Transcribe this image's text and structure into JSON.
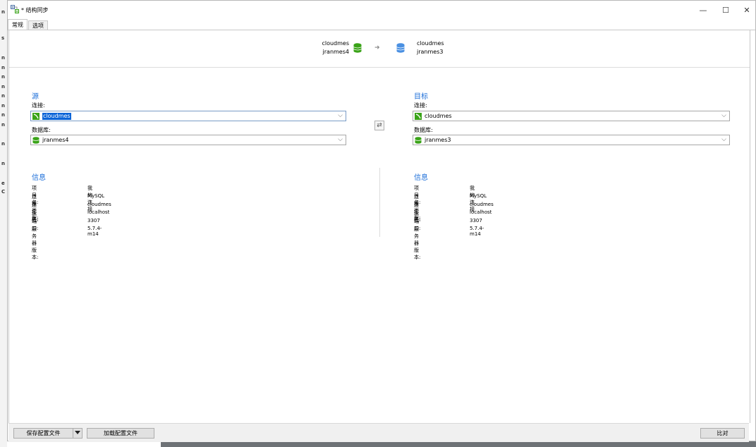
{
  "window": {
    "title": "* 结构同步",
    "min": "—",
    "max": "☐",
    "close": "✕"
  },
  "tabs": [
    {
      "label": "常规"
    },
    {
      "label": "选项"
    }
  ],
  "header": {
    "source_connection": "cloudmes",
    "source_database": "jranmes4",
    "target_connection": "cloudmes",
    "target_database": "jranmes3",
    "arrow": "➜"
  },
  "source": {
    "title": "源",
    "connection_label": "连接:",
    "connection_value": "cloudmes",
    "database_label": "数据库:",
    "database_value": "jranmes4"
  },
  "target": {
    "title": "目标",
    "connection_label": "连接:",
    "connection_value": "cloudmes",
    "database_label": "数据库:",
    "database_value": "jranmes3"
  },
  "swap_button": "⇄",
  "source_info": {
    "title": "信息",
    "rows": [
      {
        "key": "项目名:",
        "value": "我的连接"
      },
      {
        "key": "连接类型:",
        "value": "MySQL"
      },
      {
        "key": "连接名:",
        "value": "cloudmes"
      },
      {
        "key": "主机:",
        "value": "localhost"
      },
      {
        "key": "端口:",
        "value": "3307"
      },
      {
        "key": "服务器版本:",
        "value": "5.7.4-m14"
      }
    ]
  },
  "target_info": {
    "title": "信息",
    "rows": [
      {
        "key": "项目名:",
        "value": "我的连接"
      },
      {
        "key": "连接类型:",
        "value": "MySQL"
      },
      {
        "key": "连接名:",
        "value": "cloudmes"
      },
      {
        "key": "主机:",
        "value": "localhost"
      },
      {
        "key": "端口:",
        "value": "3307"
      },
      {
        "key": "服务器版本:",
        "value": "5.7.4-m14"
      }
    ]
  },
  "footer": {
    "save_profile": "保存配置文件",
    "load_profile": "加载配置文件",
    "compare": "比对"
  },
  "colors": {
    "accent": "#1e6fd9",
    "db_green": "#3aa318",
    "db_blue": "#4a90e2"
  },
  "background_letters": [
    "n",
    "s",
    "n",
    "n",
    "n",
    "n",
    "n",
    "n",
    "n",
    "n",
    "n",
    "n",
    "e",
    "C"
  ]
}
